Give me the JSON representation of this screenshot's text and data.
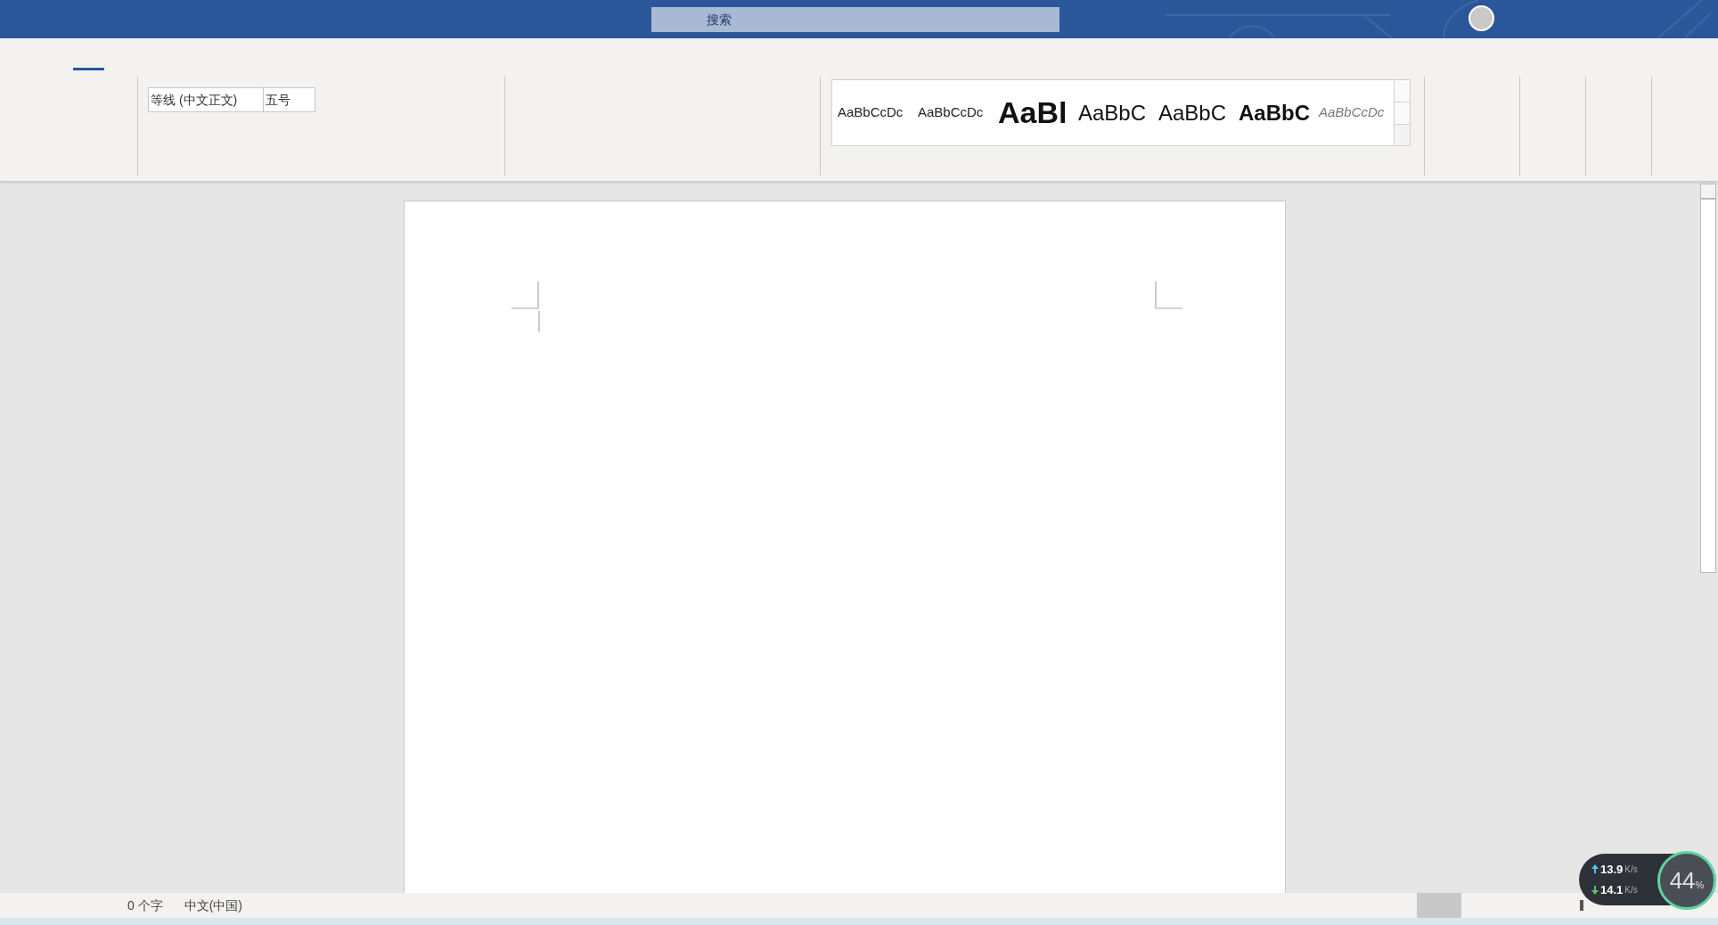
{
  "title_bar": {
    "search": {
      "placeholder": "搜索"
    }
  },
  "ribbon": {
    "font": {
      "name": "等线 (中文正文)",
      "size": "五号"
    },
    "styles": [
      {
        "sample": "AaBbCcDc",
        "kind": "normal"
      },
      {
        "sample": "AaBbCcDc",
        "kind": "normal"
      },
      {
        "sample": "AaBl",
        "kind": "title"
      },
      {
        "sample": "AaBbC",
        "kind": "heading"
      },
      {
        "sample": "AaBbC",
        "kind": "heading"
      },
      {
        "sample": "AaBbC",
        "kind": "bold"
      },
      {
        "sample": "AaBbCcDc",
        "kind": "italic"
      }
    ]
  },
  "status_bar": {
    "word_count": "0 个字",
    "language": "中文(中国)"
  },
  "network_widget": {
    "upload": "13.9",
    "download": "14.1",
    "upload_unit": "K/s",
    "download_unit": "K/s",
    "percent": "44",
    "percent_sign": "%"
  }
}
